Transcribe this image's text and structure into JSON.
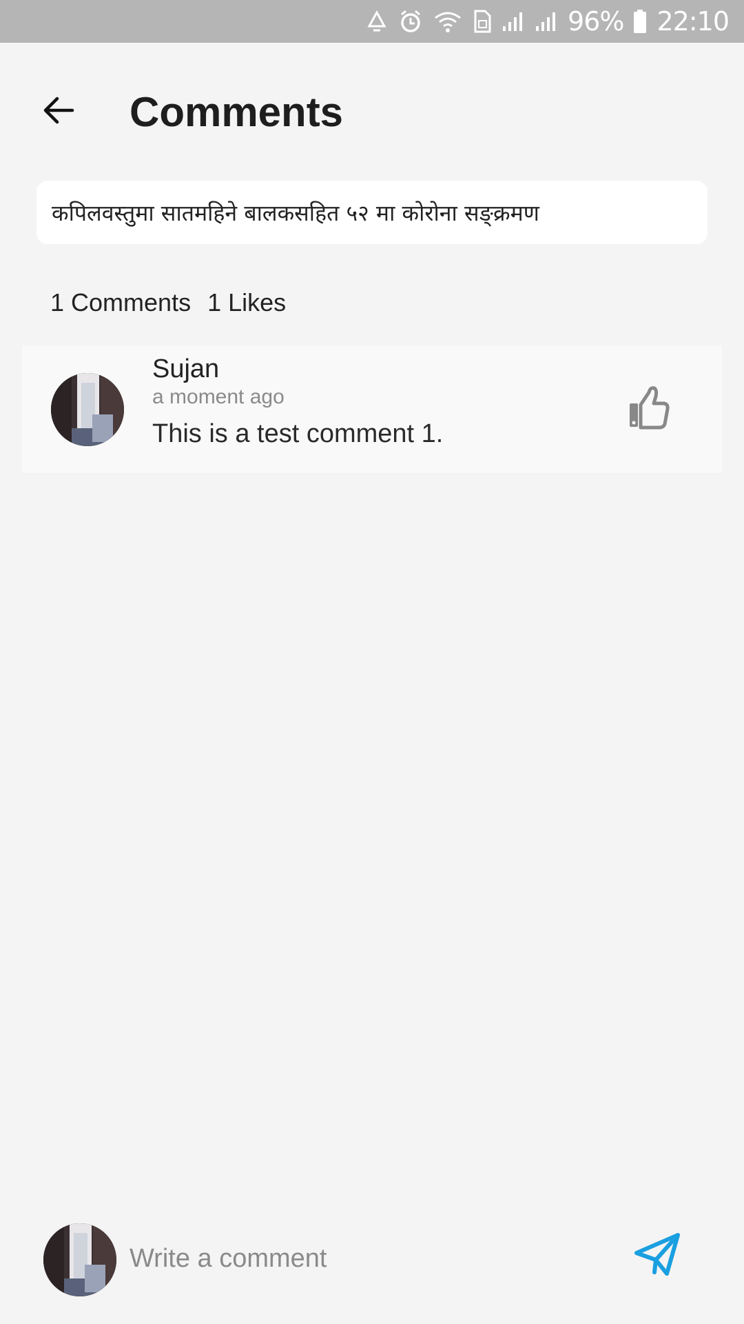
{
  "status_bar": {
    "battery_percent": "96%",
    "time": "22:10",
    "icons": [
      "recycle-icon",
      "alarm-icon",
      "wifi-icon",
      "sim-icon",
      "signal-icon",
      "signal-icon",
      "battery-icon"
    ]
  },
  "header": {
    "back_icon": "arrow-left-icon",
    "title": "Comments"
  },
  "article": {
    "headline": "कपिलवस्तुमा सातमहिने बालकसहित ५२ मा कोरोना सङ्क्रमण"
  },
  "stats": {
    "comments": "1 Comments",
    "likes": "1 Likes"
  },
  "comments": [
    {
      "author": "Sujan",
      "time": "a moment ago",
      "text": "This is a test comment 1.",
      "like_icon": "thumbs-up-icon"
    }
  ],
  "composer": {
    "placeholder": "Write a comment",
    "send_icon": "send-icon"
  },
  "colors": {
    "status_bar": "#b5b5b5",
    "background": "#f4f4f4",
    "send_accent": "#1a9fe0",
    "like_icon": "#888888"
  }
}
